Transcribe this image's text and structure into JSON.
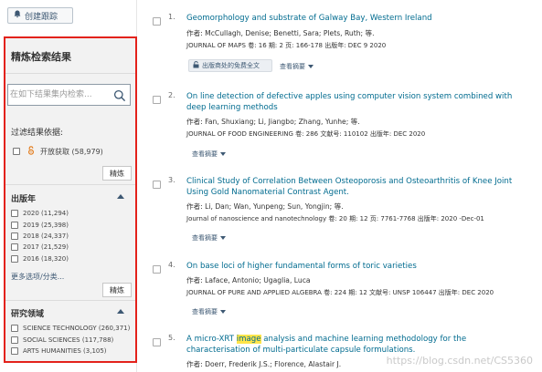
{
  "toolbar": {
    "create_alert_label": "创建跟踪"
  },
  "refine": {
    "title": "精炼检索结果",
    "search_placeholder": "在如下结果集内检索...",
    "filter_by_label": "过滤结果依据:",
    "open_access_label": "开放获取 (58,979)",
    "refine_button": "精炼",
    "year_section": {
      "title": "出版年",
      "items": [
        "2020 (11,294)",
        "2019 (25,398)",
        "2018 (24,337)",
        "2017 (21,529)",
        "2016 (18,320)"
      ],
      "more_label": "更多选项/分类...",
      "refine_button": "精炼"
    },
    "area_section": {
      "title": "研究领域",
      "items": [
        "SCIENCE TECHNOLOGY (260,371)",
        "SOCIAL SCIENCES (117,788)",
        "ARTS HUMANITIES (3,105)"
      ]
    }
  },
  "results": [
    {
      "num": "1.",
      "title": "Geomorphology and substrate of Galway Bay, Western Ireland",
      "authors_label": "作者:",
      "authors": "McCullagh, Denise; Benetti, Sara; Plets, Ruth; 等.",
      "meta": "JOURNAL OF MAPS  卷: 16   期: 2   页: 166-178   出版年: DEC 9 2020",
      "free_fulltext": "出版商处的免费全文",
      "abstract_label": "查看摘要"
    },
    {
      "num": "2.",
      "title": "On line detection of defective apples using computer vision system combined with deep learning methods",
      "authors_label": "作者:",
      "authors": "Fan, Shuxiang; Li, Jiangbo; Zhang, Yunhe; 等.",
      "meta": "JOURNAL OF FOOD ENGINEERING  卷: 286    文献号: 110102   出版年: DEC 2020",
      "abstract_label": "查看摘要"
    },
    {
      "num": "3.",
      "title": "Clinical Study of Correlation Between Osteoporosis and Osteoarthritis of Knee Joint Using Gold Nanomaterial Contrast Agent.",
      "authors_label": "作者:",
      "authors": "Li, Dan; Wan, Yunpeng; Sun, Yongjin; 等.",
      "meta": "Journal of nanoscience and nanotechnology  卷: 20   期: 12   页: 7761-7768   出版年: 2020 -Dec-01",
      "abstract_label": "查看摘要"
    },
    {
      "num": "4.",
      "title": "On base loci of higher fundamental forms of toric varieties",
      "authors_label": "作者:",
      "authors": "Laface, Antonio; Ugaglia, Luca",
      "meta": "JOURNAL OF PURE AND APPLIED ALGEBRA  卷: 224   期: 12    文献号: UNSP 106447   出版年: DEC 2020",
      "abstract_label": "查看摘要"
    },
    {
      "num": "5.",
      "title_pre": "A micro-XRT ",
      "title_hl": "image",
      "title_post": " analysis and machine learning methodology for the characterisation of multi-particulate capsule formulations.",
      "authors_label": "作者:",
      "authors": "Doerr, Frederik J.S.; Florence, Alastair J."
    }
  ],
  "watermark": "https://blog.csdn.net/CS5360",
  "colors": {
    "accent": "#006b8f",
    "highlight": "#e3221b",
    "panel_bg": "#f2f2f2",
    "hit": "#ffe54a"
  }
}
